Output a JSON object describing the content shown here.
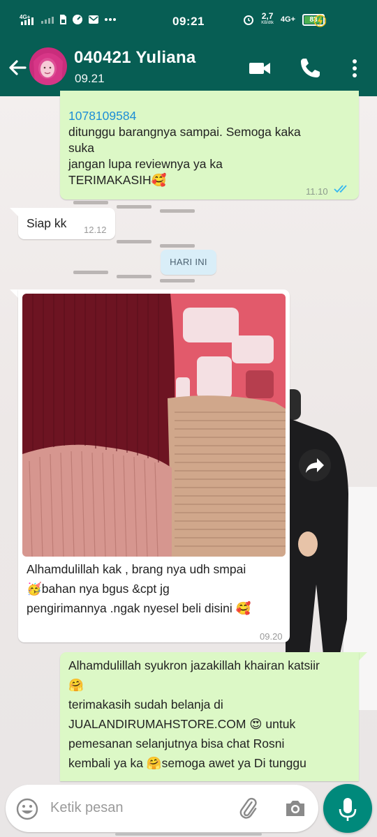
{
  "statusbar": {
    "network_1": "4G+",
    "time": "09:21",
    "speed": "2,7",
    "speed_unit": "KB/dtk",
    "network_2": "4G+",
    "battery": "83"
  },
  "header": {
    "contact_name": "040421 Yuliana",
    "last_seen": "09.21"
  },
  "messages": {
    "m1": {
      "line_link": "1078109584",
      "line_2": "ditunggu barangnya sampai. Semoga kaka",
      "line_3": "suka",
      "line_4": "jangan lupa reviewnya ya ka",
      "line_5": "TERIMAKASIH🥰",
      "time": "11.10"
    },
    "m2": {
      "text": "Siap kk",
      "time": "12.12"
    },
    "date_divider": "HARI INI",
    "m3": {
      "line_1": "Alhamdulillah kak , brang nya udh smpai",
      "line_2": "🥳bahan nya bgus &cpt jg",
      "line_3": "pengirimannya .ngak nyesel beli disini 🥰",
      "time": "09.20"
    },
    "m4": {
      "line_1": "Alhamdulillah syukron jazakillah khairan katsiir",
      "line_2": "🤗",
      "line_3": "terimakasih sudah belanja di",
      "line_4": "JUALANDIRUMAHSTORE.COM 😍 untuk",
      "line_5": "pemesanan selanjutnya bisa chat Rosni",
      "line_6": "kembali ya ka 🤗semoga awet ya Di tunggu"
    }
  },
  "input": {
    "placeholder": "Ketik pesan"
  },
  "colors": {
    "header": "#075e54",
    "outgoing_bubble": "#dcf8c6",
    "incoming_bubble": "#ffffff",
    "read_ticks": "#34b7f1",
    "mic_button": "#00897b"
  },
  "icons": [
    "back-arrow-icon",
    "video-call-icon",
    "phone-icon",
    "more-vert-icon",
    "double-check-icon",
    "forward-icon",
    "emoji-icon",
    "attach-icon",
    "camera-icon",
    "mic-icon"
  ]
}
